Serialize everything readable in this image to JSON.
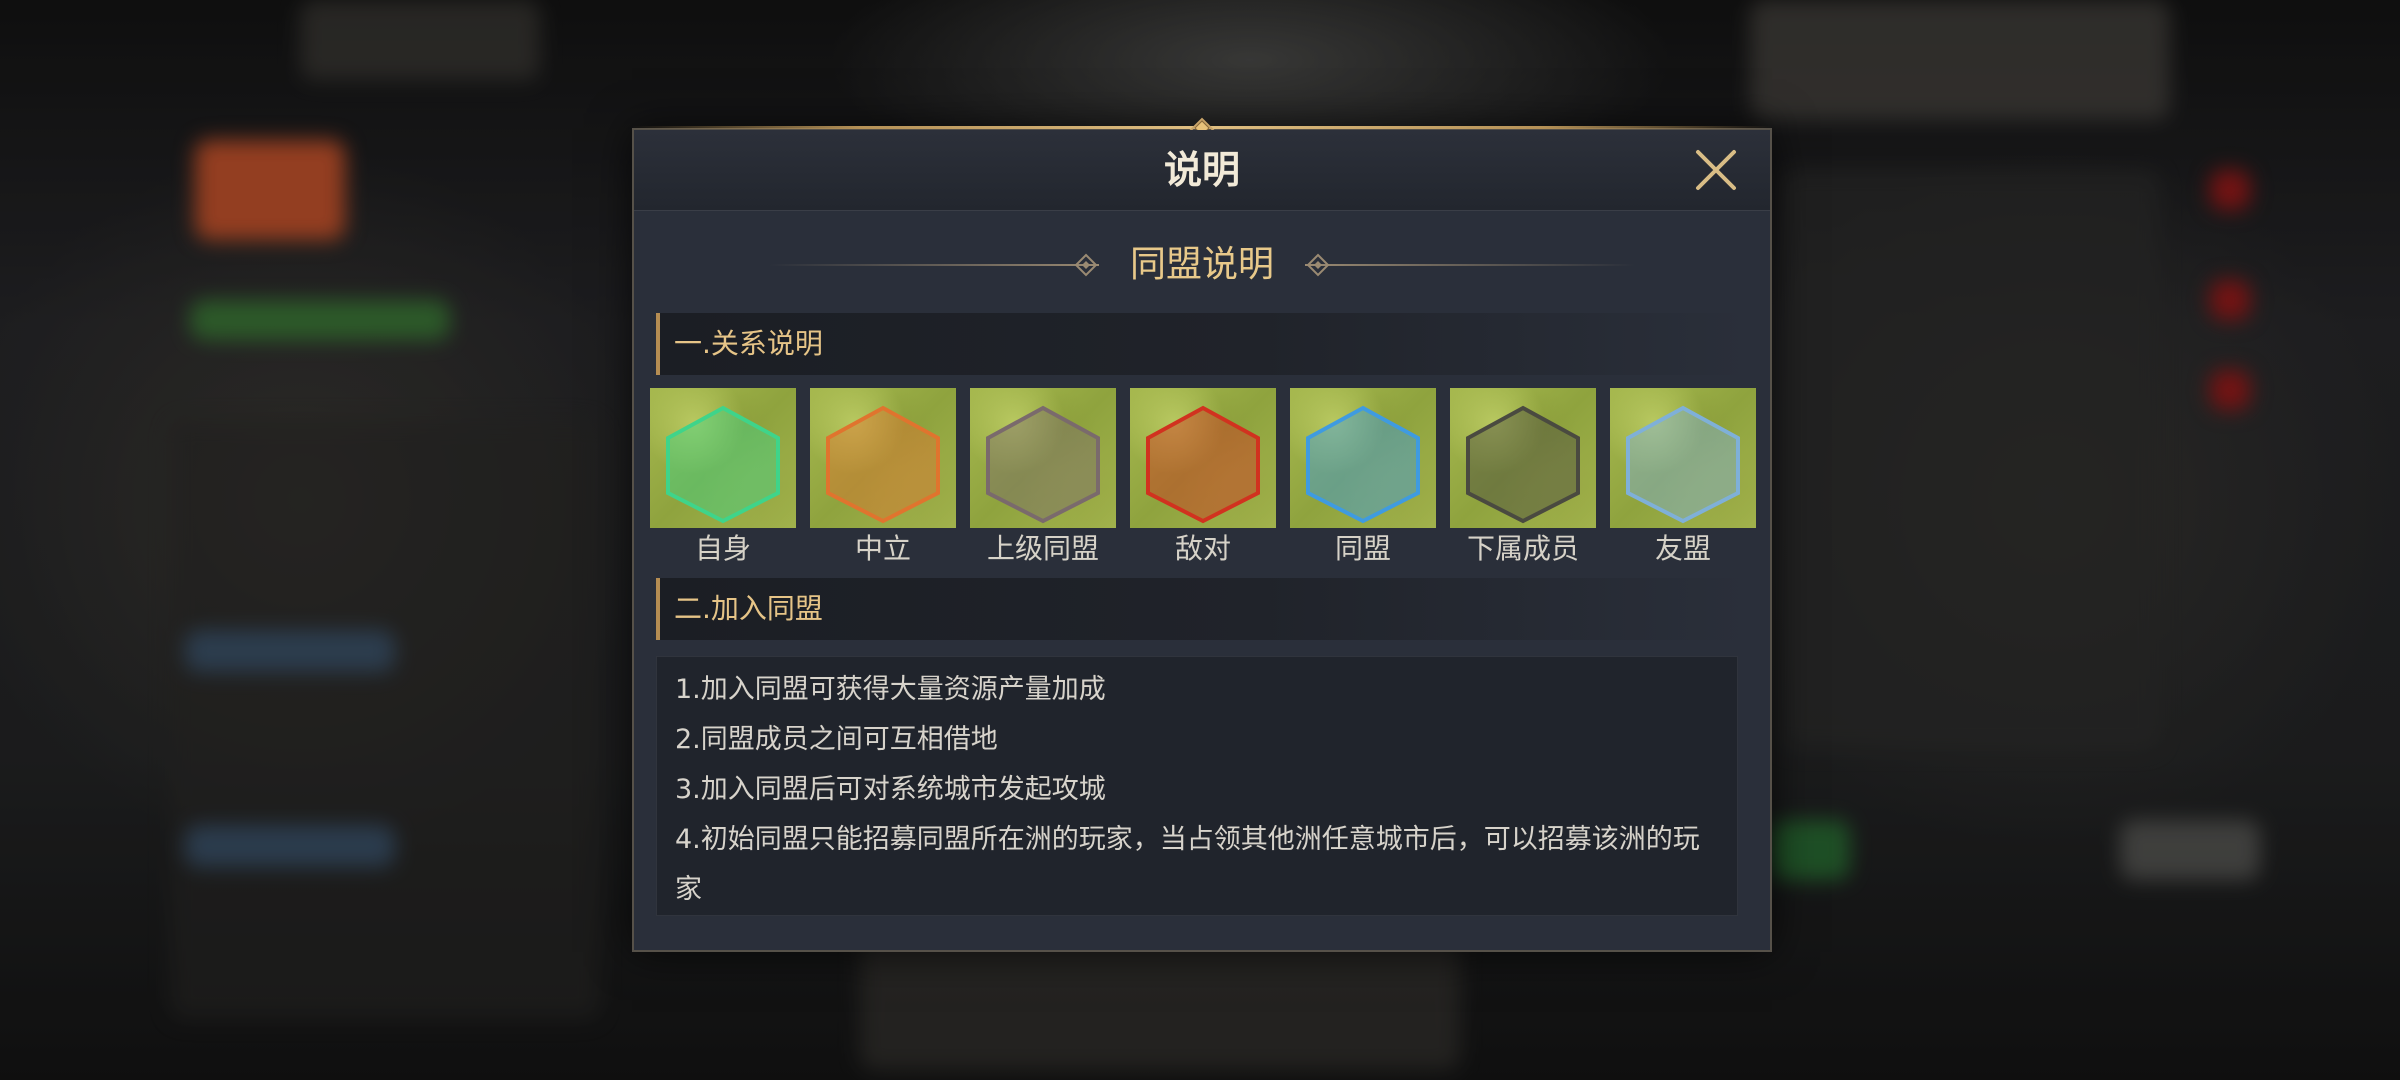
{
  "dialog": {
    "title": "说明",
    "subtitle": "同盟说明",
    "section1": {
      "heading": "一.关系说明",
      "tiles": [
        {
          "label": "自身",
          "color": "#3fd48a"
        },
        {
          "label": "中立",
          "color": "#e0742e"
        },
        {
          "label": "上级同盟",
          "color": "#7a6a6c"
        },
        {
          "label": "敌对",
          "color": "#d1321f"
        },
        {
          "label": "同盟",
          "color": "#3f9be0"
        },
        {
          "label": "下属成员",
          "color": "#4a4a40"
        },
        {
          "label": "友盟",
          "color": "#7fb0d8"
        }
      ]
    },
    "section2": {
      "heading": "二.加入同盟",
      "rules": [
        "1.加入同盟可获得大量资源产量加成",
        "2.同盟成员之间可互相借地",
        "3.加入同盟后可对系统城市发起攻城",
        "4.初始同盟只能招募同盟所在洲的玩家，当占领其他洲任意城市后，可以招募该洲的玩家"
      ]
    }
  },
  "icons": {
    "close": "close-icon",
    "ornament": "diamond-ornament-icon",
    "hex": "hexagon-territory-icon"
  },
  "colors": {
    "gold": "#e8c98a",
    "panel": "#2a2f3a"
  }
}
